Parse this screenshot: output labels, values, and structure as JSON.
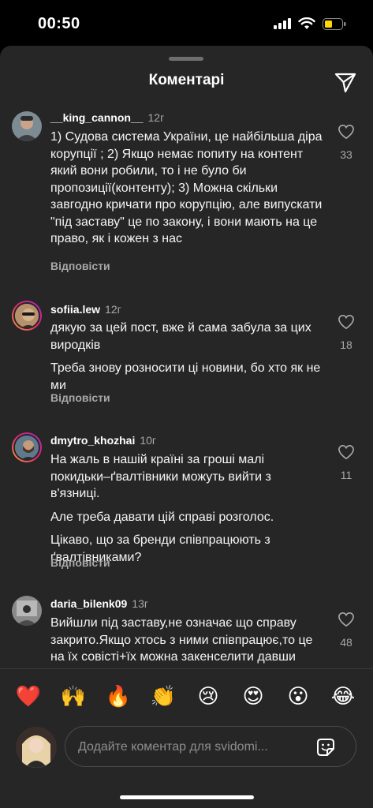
{
  "status": {
    "time": "00:50"
  },
  "sheet": {
    "title": "Коментарі"
  },
  "comments": [
    {
      "username": "__king_cannon__",
      "ago": "12г",
      "paragraphs": [
        "1) Судова система України, це найбільша діра корупції ; 2) Якщо немає попиту на контент який вони робили, то і не було би пропозиції(контенту); 3) Можна скільки завгодно кричати про корупцію, але випускати \"під заставу\" це по закону, і вони мають на це право, як і кожен з нас"
      ],
      "reply": "Відповісти",
      "likes": "33"
    },
    {
      "username": "sofiia.lew",
      "ago": "12г",
      "paragraphs": [
        "дякую за цей пост, вже й сама забула за цих виродків",
        "Треба знову розносити ці новини, бо хто як не ми"
      ],
      "reply": "Відповісти",
      "likes": "18"
    },
    {
      "username": "dmytro_khozhai",
      "ago": "10г",
      "paragraphs": [
        "На жаль в нашій країні за гроші малі покидьки–ґвалтівники можуть вийти з в'язниці.",
        "Але треба давати цій справі розголос.",
        "Цікаво, що за бренди співпрацюють з ґвалтівниками?"
      ],
      "reply": "Відповісти",
      "likes": "11"
    },
    {
      "username": "daria_bilenk09",
      "ago": "13г",
      "paragraphs": [
        "Вийшли під заставу,не означає що справу закрито.Якщо хтось з ними співпрацює,то це на їх совісті+їх можна закенселити давши поштовх у"
      ],
      "reply": "",
      "likes": "48"
    }
  ],
  "reactions": [
    "❤️",
    "🙌",
    "🔥",
    "👏",
    "😢",
    "😍",
    "😮",
    "😂"
  ],
  "composer": {
    "placeholder": "Додайте коментар для svidomi..."
  }
}
